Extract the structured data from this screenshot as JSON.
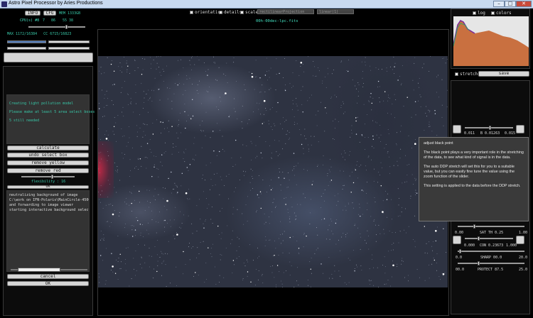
{
  "window": {
    "title": "Astro Pixel Processor by  Aries Productions",
    "buttons": [
      "–",
      "□",
      "✕"
    ]
  },
  "top_left": {
    "info_btn": "INFO",
    "cfg_btn": "CFG",
    "mem": "MEM 1333GB",
    "cpu_label": "CPU(s) #8",
    "cpu_values": [
      "7",
      "86",
      "55 38"
    ],
    "coords": "MAX 1172/16384   CC 6715/16823"
  },
  "top_bar": {
    "orientation": "orientation",
    "details": "details",
    "scale": "scale",
    "projection": "rectilinearProjection",
    "zoom": "linear(1)",
    "filename": "00h-00dec-lpc.fits"
  },
  "left_panel": {
    "status_lines": [
      "Creating light pollution model",
      "",
      "Please make at least 5 area select boxes",
      "",
      "5 still needed"
    ],
    "buttons": {
      "calculate": "calculate",
      "undo": "undo select box",
      "remove_yellow": "remove yellow",
      "remove_red": "remove red"
    },
    "flexibility": "flexibility : 16",
    "ok_small": "OK",
    "log_lines": [
      "neutralizing background of image",
      "C:\\work on IFN-Polaris\\MainCircle-4500\\LP",
      "and forwarding to image viewer",
      "starting interactive background selector"
    ],
    "cancel": "cancel",
    "ok": "OK"
  },
  "right_panel": {
    "log_label": "log",
    "colors_label": "colors",
    "stretch_label": "stretch",
    "save_label": "save",
    "bp_row": [
      "0.011",
      "B 0.01263",
      "0.015"
    ],
    "sat_row": [
      "0.00",
      "SAT TH 0.25",
      "1.00"
    ],
    "con_row": [
      "0.000",
      "CON 0.23673",
      "1.000"
    ],
    "sharp_row": [
      "0.0",
      "SHARP 00.0",
      "20.0"
    ],
    "protect_row": [
      "00.0",
      "PROTECT 87.5",
      "25.0"
    ]
  },
  "tooltip": {
    "title": "adjust black point",
    "p1": "The black point plays a very important role in the stretching of the data, to see what kind of signal is in the data.",
    "p2": "The auto DDP stretch will set this for you to a suitable value, but you can easily fine tune the value using the zoom function of the slider.",
    "p3": "This setting is applied to the data before the DDP stretch."
  }
}
